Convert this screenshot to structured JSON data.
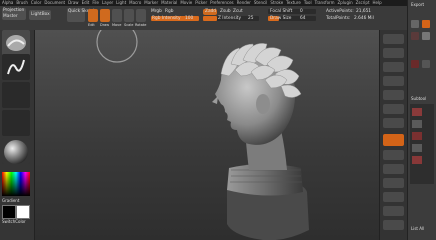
{
  "menu": [
    "Alpha",
    "Brush",
    "Color",
    "Document",
    "Draw",
    "Edit",
    "File",
    "Layer",
    "Light",
    "Macro",
    "Marker",
    "Material",
    "Movie",
    "Picker",
    "Preferences",
    "Render",
    "Stencil",
    "Stroke",
    "Texture",
    "Tool",
    "Transform",
    "Zplugin",
    "Zscript",
    "Help"
  ],
  "toolbar": {
    "projection": "Projection",
    "master": "Master",
    "lightbox": "LightBox",
    "quick_sketch": "Quick Sketch",
    "edit": "Edit",
    "draw": "Draw",
    "move": "Move",
    "scale": "Scale",
    "rotate": "Rotate",
    "mrgb": "Mrgb",
    "rgb": "Rgb",
    "m": "M",
    "zadd": "Zadd",
    "zsub": "Zsub",
    "zcut": "Zcut",
    "rgb_intensity_label": "Rgb Intensity",
    "rgb_intensity_value": "100",
    "z_intensity_label": "Z Intensity",
    "z_intensity_value": "25",
    "focal_shift_label": "Focal Shift",
    "focal_shift_value": "0",
    "draw_size_label": "Draw Size",
    "draw_size_value": "64",
    "active_points_label": "ActivePoints:",
    "active_points_value": "21,651",
    "total_points_label": "TotalPoints:",
    "total_points_value": "2.646 Mil"
  },
  "left_shelf": {
    "gradient_label": "Gradient",
    "switch_color_label": "SwitchColor"
  },
  "right_panel": {
    "title": "Export",
    "list_all": "List All",
    "subtool_title": "Subtool"
  },
  "colors": {
    "accent": "#d96a1c",
    "panel": "#3a3a3a",
    "viewport_top": "#505050",
    "viewport_bottom": "#2e2e2e"
  }
}
